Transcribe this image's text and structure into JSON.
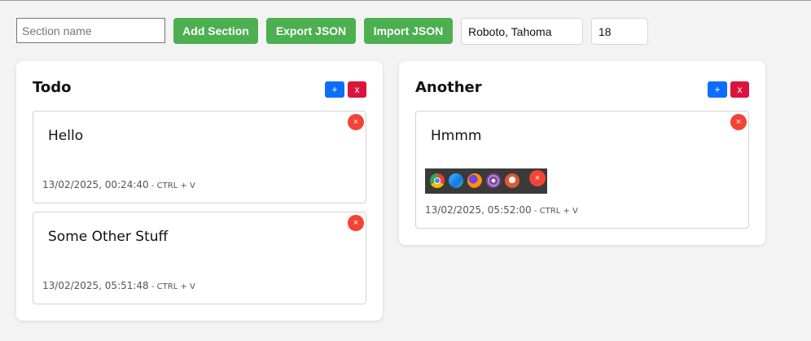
{
  "toolbar": {
    "section_name_placeholder": "Section name",
    "add_section_label": "Add Section",
    "export_label": "Export JSON",
    "import_label": "Import JSON",
    "font_family_value": "Roboto, Tahoma",
    "font_size_value": "18"
  },
  "colors": {
    "primary_green": "#4caf50",
    "add_blue": "#0d6efd",
    "delete_red": "#dc143c",
    "note_delete_red": "#f44336"
  },
  "sections": [
    {
      "title": "Todo",
      "add_label": "+",
      "delete_label": "x",
      "notes": [
        {
          "text": "Hello",
          "date": "13/02/2025, 00:24:40",
          "hint": " - CTRL + V",
          "delete_label": "×"
        },
        {
          "text": "Some Other Stuff",
          "date": "13/02/2025, 05:51:48",
          "hint": " - CTRL + V",
          "delete_label": "×"
        }
      ]
    },
    {
      "title": "Another",
      "add_label": "+",
      "delete_label": "x",
      "notes": [
        {
          "text": "Hmmm",
          "date": "13/02/2025, 05:52:00",
          "hint": " - CTRL + V",
          "delete_label": "×",
          "image_delete_label": "×",
          "image_icons": [
            "chrome-icon",
            "edge-icon",
            "firefox-icon",
            "tor-browser-icon",
            "duckduckgo-icon"
          ]
        }
      ]
    }
  ]
}
